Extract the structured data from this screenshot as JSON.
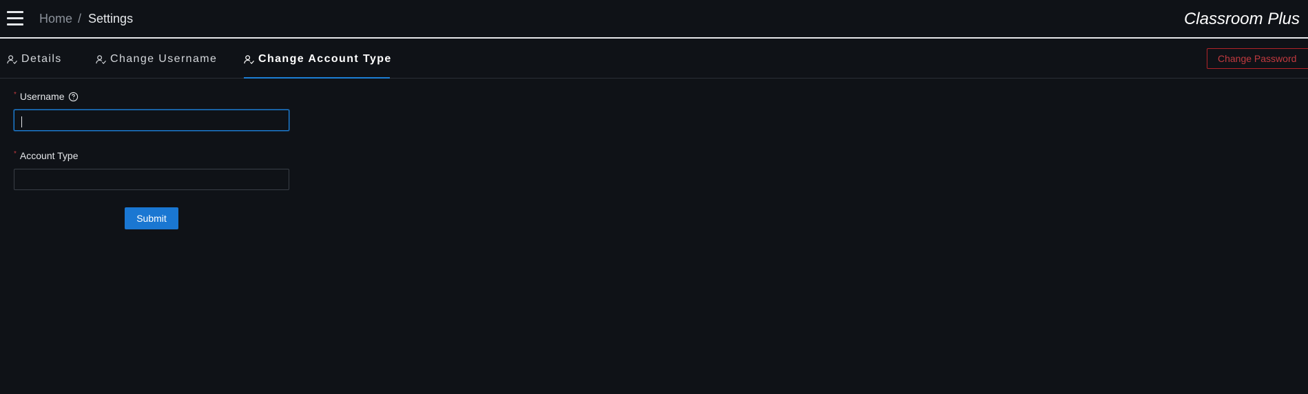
{
  "header": {
    "breadcrumb": {
      "home": "Home",
      "separator": "/",
      "current": "Settings"
    },
    "app_title": "Classroom Plus",
    "menu_icon": "hamburger-menu-icon"
  },
  "tabs": [
    {
      "label": "Details",
      "icon": "user-check-icon",
      "active": false
    },
    {
      "label": "Change Username",
      "icon": "user-check-icon",
      "active": false
    },
    {
      "label": "Change Account Type",
      "icon": "user-check-icon",
      "active": true
    }
  ],
  "actions": {
    "change_password_label": "Change Password"
  },
  "form": {
    "username": {
      "label": "Username",
      "required_marker": "*",
      "value": "",
      "placeholder": "",
      "help_icon": "question-circle-icon"
    },
    "account_type": {
      "label": "Account Type",
      "required_marker": "*",
      "value": "",
      "placeholder": ""
    },
    "submit_label": "Submit"
  },
  "colors": {
    "background": "#0f1217",
    "accent": "#1c7fd6",
    "danger": "#c23a3f",
    "text": "#e6e8eb",
    "muted": "#8b919a"
  }
}
